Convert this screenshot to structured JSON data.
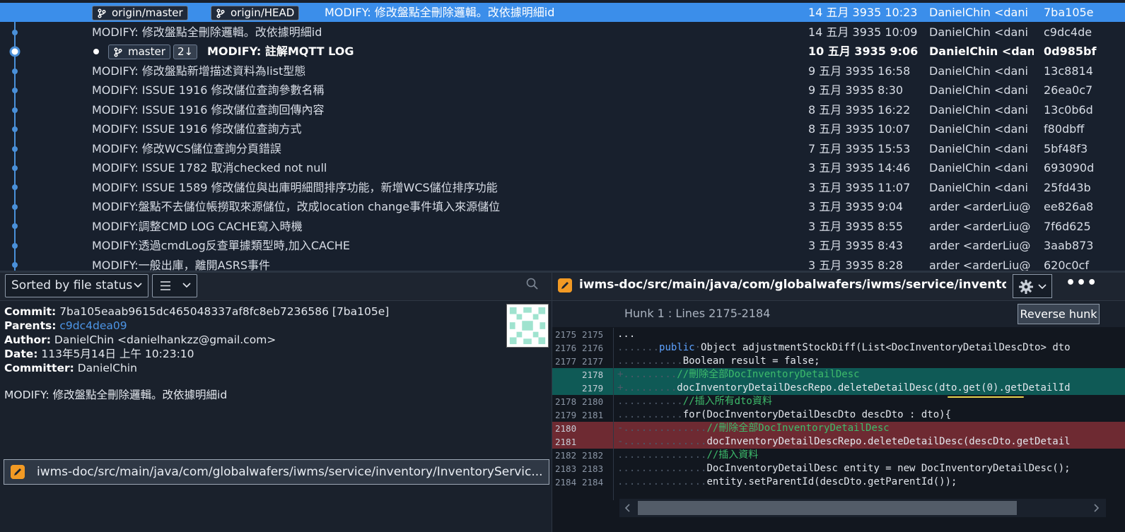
{
  "commits": [
    {
      "message": "MODIFY: 修改盤點全刪除邏輯。改依據明細id",
      "date": "14 五月 3935 10:23",
      "author": "DanielChin <dani",
      "hash": "7ba105e",
      "refs": [
        "origin/master",
        "origin/HEAD"
      ]
    },
    {
      "message": "MODIFY: 修改盤點全刪除邏輯。改依據明細id",
      "date": "14 五月 3935 10:09",
      "author": "DanielChin <dani",
      "hash": "c9dc4de"
    },
    {
      "message": "MODIFY: 註解MQTT LOG",
      "date": "10 五月 3935 9:06",
      "author": "DanielChin <dan",
      "hash": "0d985bf",
      "refs": [
        "master"
      ],
      "ahead": "2↓"
    },
    {
      "message": "MODIFY: 修改盤點新增描述資料為list型態",
      "date": "9 五月 3935 16:58",
      "author": "DanielChin <dani",
      "hash": "13c8814"
    },
    {
      "message": "MODIFY: ISSUE 1916 修改儲位查詢參數名稱",
      "date": "9 五月 3935 8:30",
      "author": "DanielChin <dani",
      "hash": "26ea0c7"
    },
    {
      "message": "MODIFY: ISSUE 1916 修改儲位查詢回傳內容",
      "date": "8 五月 3935 16:22",
      "author": "DanielChin <dani",
      "hash": "13c0b6d"
    },
    {
      "message": "MODIFY: ISSUE 1916 修改儲位查詢方式",
      "date": "8 五月 3935 10:07",
      "author": "DanielChin <dani",
      "hash": "f80dbff"
    },
    {
      "message": "MODIFY: 修改WCS儲位查詢分頁錯誤",
      "date": "7 五月 3935 15:53",
      "author": "DanielChin <dani",
      "hash": "5bf48f3"
    },
    {
      "message": "MODIFY: ISSUE 1782 取消checked not null",
      "date": "3 五月 3935 14:46",
      "author": "DanielChin <dani",
      "hash": "693090d"
    },
    {
      "message": "MODIFY: ISSUE 1589 修改儲位與出庫明細間排序功能，新增WCS儲位排序功能",
      "date": "3 五月 3935 11:07",
      "author": "DanielChin <dani",
      "hash": "25fd43b"
    },
    {
      "message": "MODIFY:盤點不去儲位帳撈取來源儲位，改成location change事件填入來源儲位",
      "date": "3 五月 3935 9:04",
      "author": "arder <arderLiu@",
      "hash": "ee826a8"
    },
    {
      "message": "MODIFY:調整CMD LOG CACHE寫入時機",
      "date": "3 五月 3935 8:55",
      "author": "arder <arderLiu@",
      "hash": "7f6d625"
    },
    {
      "message": "MODIFY:透過cmdLog反查單據類型時,加入CACHE",
      "date": "3 五月 3935 8:43",
      "author": "arder <arderLiu@",
      "hash": "3aab873"
    },
    {
      "message": "MODIFY:一般出庫，離開ASRS事件",
      "date": "3 五月 3935 8:28",
      "author": "arder <arderLiu@",
      "hash": "620c0cf"
    }
  ],
  "toolbar": {
    "sort_label": "Sorted by file status",
    "view_icon": "list-icon",
    "search_icon": "search-icon"
  },
  "commit_info": {
    "commit_label": "Commit:",
    "commit_value": "7ba105eaab9615dc465048337af8fc8eb7236586 [7ba105e]",
    "parents_label": "Parents:",
    "parents_value": "c9dc4dea09",
    "author_label": "Author:",
    "author_value": "DanielChin <danielhankzz@gmail.com>",
    "date_label": "Date:",
    "date_value": "113年5月14日 上午 10:23:10",
    "committer_label": "Committer:",
    "committer_value": "DanielChin",
    "message": "MODIFY: 修改盤點全刪除邏輯。改依據明細id",
    "file_path": "iwms-doc/src/main/java/com/globalwafers/iwms/service/inventory/InventoryServic..."
  },
  "diff": {
    "file_path": "iwms-doc/src/main/java/com/globalwafers/iwms/service/inventory/Invent...",
    "hunk_label": "Hunk 1 : Lines 2175-2184",
    "reverse_label": "Reverse hunk",
    "more_label": "•••",
    "lines": [
      {
        "old": "2175",
        "new": "2175",
        "type": "ctx"
      },
      {
        "old": "2176",
        "new": "2176",
        "type": "ctx"
      },
      {
        "old": "2177",
        "new": "2177",
        "type": "ctx"
      },
      {
        "old": "",
        "new": "2178",
        "type": "add"
      },
      {
        "old": "",
        "new": "2179",
        "type": "add"
      },
      {
        "old": "2178",
        "new": "2180",
        "type": "ctx"
      },
      {
        "old": "2179",
        "new": "2181",
        "type": "ctx"
      },
      {
        "old": "2180",
        "new": "",
        "type": "del"
      },
      {
        "old": "2181",
        "new": "",
        "type": "del"
      },
      {
        "old": "2182",
        "new": "2182",
        "type": "ctx"
      },
      {
        "old": "2183",
        "new": "2183",
        "type": "ctx"
      },
      {
        "old": "2184",
        "new": "2184",
        "type": "ctx"
      }
    ],
    "code": [
      "...",
      "public Object adjustmentStockDiff(List<DocInventoryDetailDescDto> dto",
      "Boolean result = false;",
      "//刪除全部DocInventoryDetailDesc",
      "docInventoryDetailDescRepo.deleteDetailDesc(dto.get(0).getDetailId",
      "//插入所有dto資料",
      "for(DocInventoryDetailDescDto descDto : dto){",
      "//刪除全部DocInventoryDetailDesc",
      "docInventoryDetailDescRepo.deleteDetailDesc(descDto.getDetail",
      "//插入資料",
      "DocInventoryDetailDesc entity = new DocInventoryDetailDesc();",
      "entity.setParentId(descDto.getParentId());"
    ]
  },
  "colors": {
    "selection": "#3b8eea",
    "graph_line": "#4a90d9",
    "added": "#0f5a56",
    "removed": "#6e2a32",
    "accent_file_icon": "#f29a24"
  }
}
